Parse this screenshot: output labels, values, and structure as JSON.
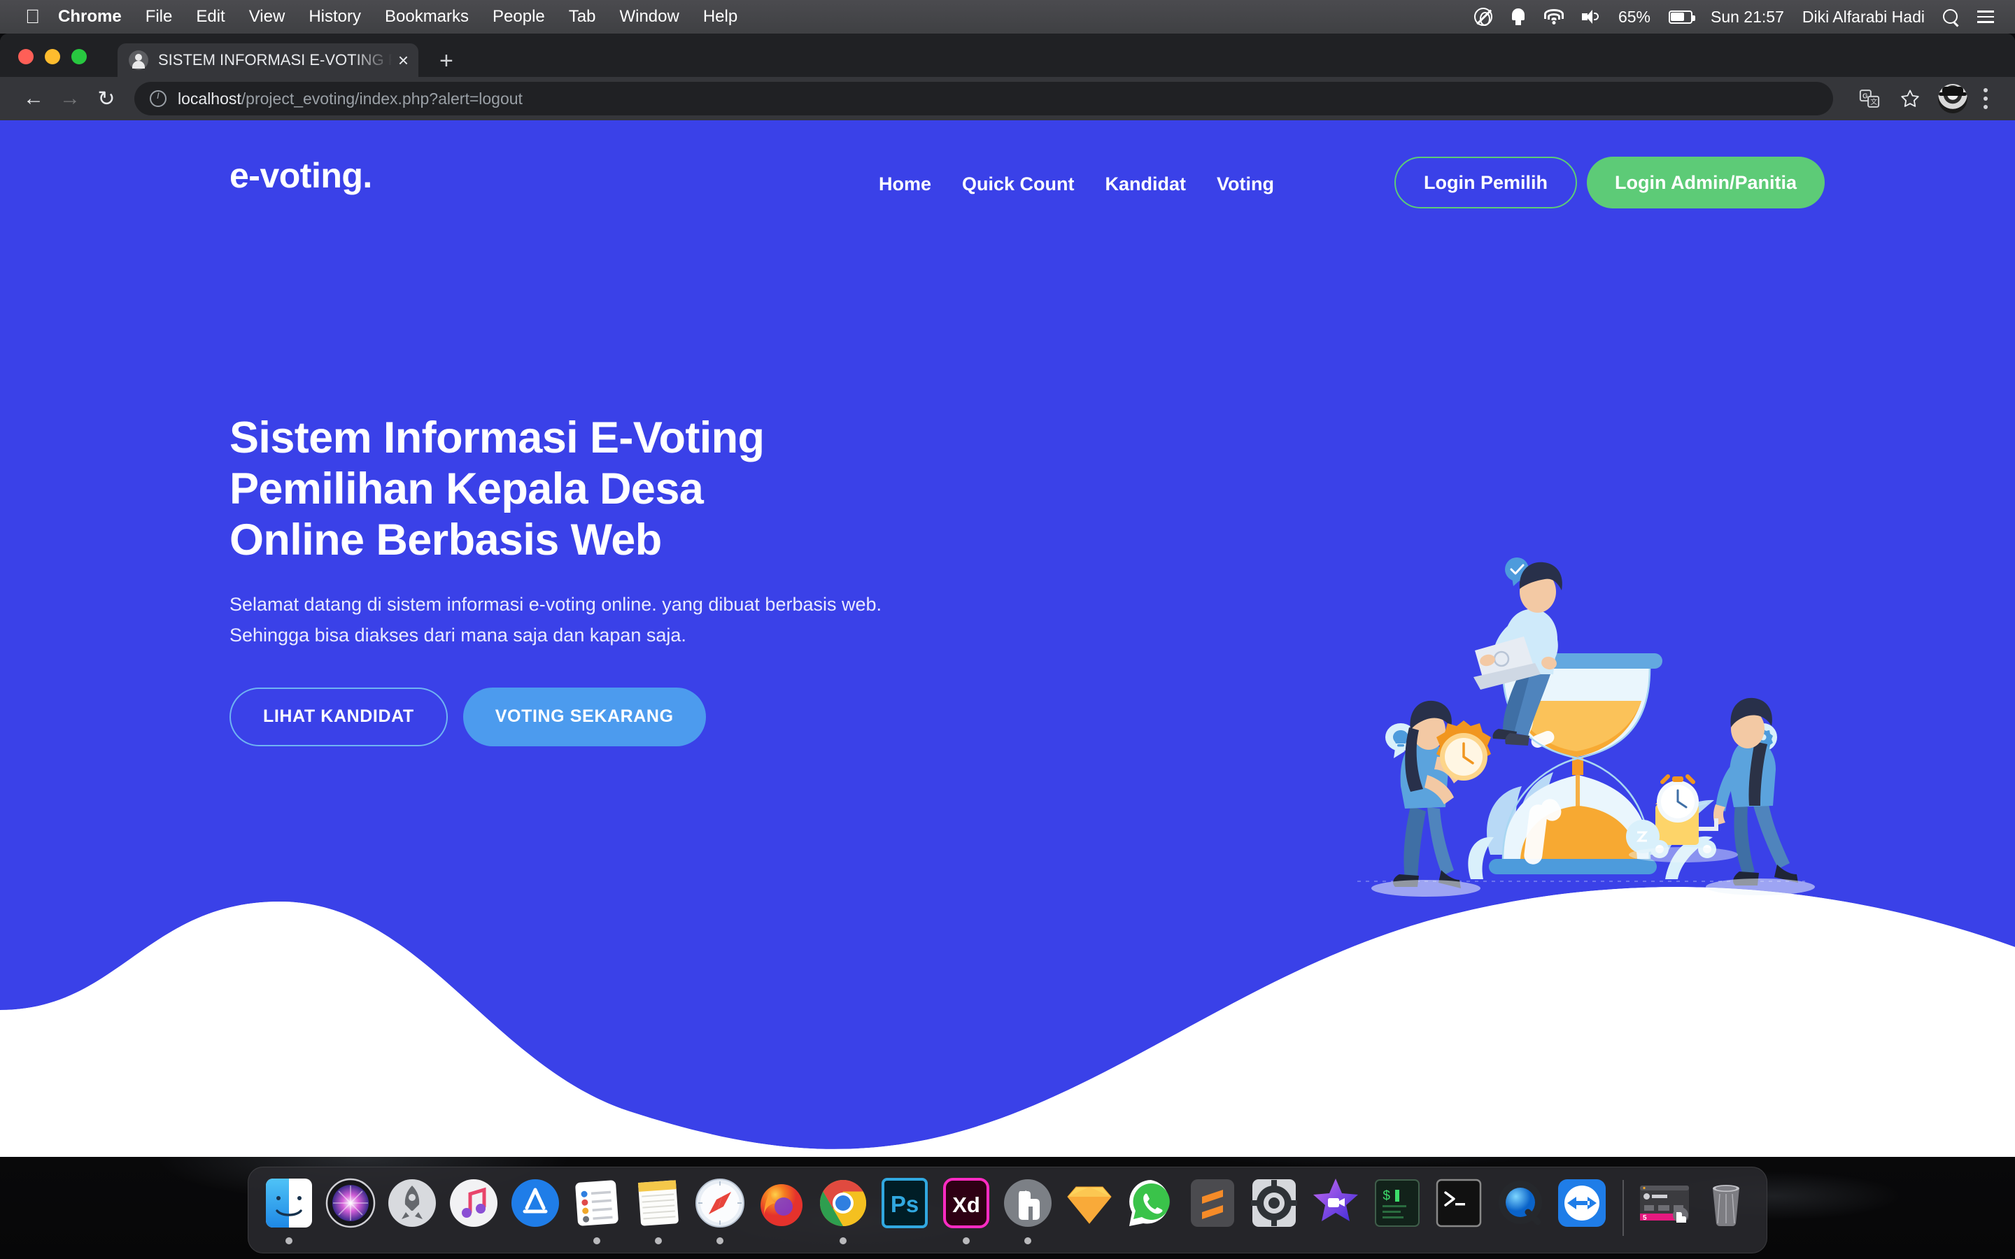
{
  "menubar": {
    "apple_icon": "apple-logo-icon",
    "items": [
      {
        "label": "Chrome",
        "bold": true
      },
      {
        "label": "File",
        "bold": false
      },
      {
        "label": "Edit",
        "bold": false
      },
      {
        "label": "View",
        "bold": false
      },
      {
        "label": "History",
        "bold": false
      },
      {
        "label": "Bookmarks",
        "bold": false
      },
      {
        "label": "People",
        "bold": false
      },
      {
        "label": "Tab",
        "bold": false
      },
      {
        "label": "Window",
        "bold": false
      },
      {
        "label": "Help",
        "bold": false
      }
    ],
    "status": {
      "creative_cloud_icon": "creative-cloud-icon",
      "notification_icon": "bell-icon",
      "wifi_icon": "wifi-icon",
      "volume_icon": "volume-icon",
      "battery_percent": "65%",
      "battery_icon": "battery-icon",
      "clock": "Sun 21:57",
      "user": "Diki Alfarabi Hadi",
      "search_icon": "search-icon",
      "control_center_icon": "control-center-icon"
    }
  },
  "browser": {
    "window_controls": {
      "close": "close-window-button",
      "minimize": "minimize-window-button",
      "zoom": "zoom-window-button"
    },
    "tab": {
      "title": "SISTEM INFORMASI E-VOTING P",
      "favicon": "site-favicon",
      "close_label": "×"
    },
    "new_tab_label": "+",
    "nav": {
      "back": "←",
      "forward": "→",
      "reload": "↻"
    },
    "omnibox": {
      "security_icon": "info-circle-icon",
      "host": "localhost",
      "path": "/project_evoting/index.php?alert=logout",
      "full_url": "localhost/project_evoting/index.php?alert=logout"
    },
    "toolbar_icons": {
      "translate": "google-translate-icon",
      "bookmark": "star-bookmark-icon",
      "profile": "profile-avatar",
      "menu": "three-dot-menu-icon"
    }
  },
  "site": {
    "brand": "e-voting.",
    "colors": {
      "background": "#3A41E8",
      "accent_green": "#5DCB77",
      "accent_sky": "#4C9BEE",
      "wave_fill": "#FFFFFF"
    },
    "nav_links": [
      {
        "label": "Home"
      },
      {
        "label": "Quick Count"
      },
      {
        "label": "Kandidat"
      },
      {
        "label": "Voting"
      }
    ],
    "nav_buttons": {
      "login_pemilih": "Login Pemilih",
      "login_admin": "Login Admin/Panitia"
    },
    "hero": {
      "heading_line1_thin": "Sistem Informasi ",
      "heading_line1_strong": "E-Voting",
      "heading_line2": "Pemilihan Kepala Desa",
      "heading_line3": "Online Berbasis Web",
      "lead_line1": "Selamat datang di sistem informasi e-voting online. yang dibuat berbasis web.",
      "lead_line2": "Sehingga bisa diakses dari mana saja dan kapan saja.",
      "cta_primary": "LIHAT KANDIDAT",
      "cta_secondary": "VOTING SEKARANG",
      "illustration": "time-management-hourglass-illustration"
    }
  },
  "dock": {
    "items": [
      {
        "name": "finder-icon",
        "running": true
      },
      {
        "name": "siri-icon",
        "running": false
      },
      {
        "name": "launchpad-icon",
        "running": false
      },
      {
        "name": "itunes-icon",
        "running": false
      },
      {
        "name": "app-store-icon",
        "running": false
      },
      {
        "name": "reminders-icon",
        "running": true
      },
      {
        "name": "notes-icon",
        "running": true
      },
      {
        "name": "safari-icon",
        "running": true
      },
      {
        "name": "firefox-icon",
        "running": false
      },
      {
        "name": "chrome-icon",
        "running": true
      },
      {
        "name": "photoshop-icon",
        "running": false
      },
      {
        "name": "adobe-xd-icon",
        "running": true
      },
      {
        "name": "evernote-icon",
        "running": true
      },
      {
        "name": "sketch-icon",
        "running": false
      },
      {
        "name": "whatsapp-icon",
        "running": false
      },
      {
        "name": "sublime-text-icon",
        "running": false
      },
      {
        "name": "system-preferences-icon",
        "running": false
      },
      {
        "name": "imovie-icon",
        "running": false
      },
      {
        "name": "iterm-icon",
        "running": false
      },
      {
        "name": "terminal-icon",
        "running": false
      },
      {
        "name": "quicktime-icon",
        "running": false
      },
      {
        "name": "teamviewer-icon",
        "running": false
      }
    ],
    "minimized": [
      {
        "name": "mamp-window-thumbnail",
        "running": false
      }
    ],
    "trash": {
      "name": "trash-icon"
    }
  }
}
